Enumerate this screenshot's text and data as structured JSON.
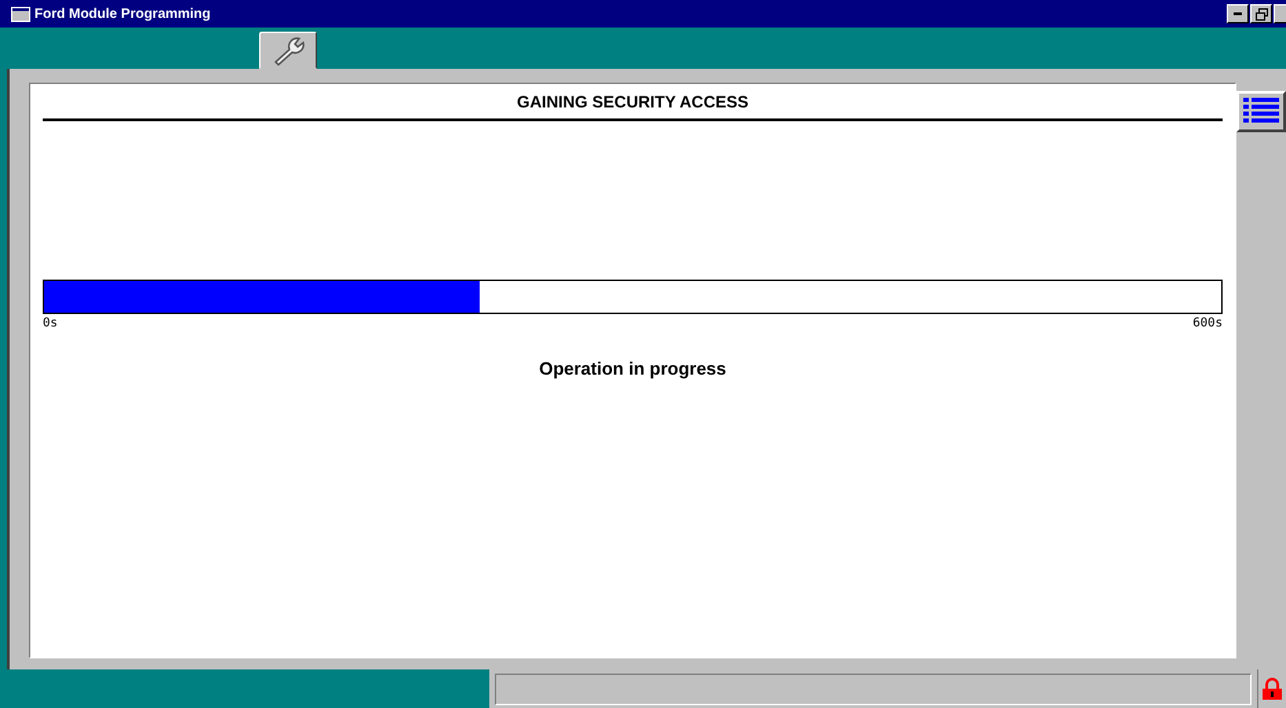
{
  "window": {
    "title": "Ford Module Programming"
  },
  "tabs": [
    {
      "kind": "wrench",
      "selected": true
    }
  ],
  "panel": {
    "heading": "GAINING SECURITY ACCESS",
    "progress": {
      "level": 0.37,
      "min_label": "0s",
      "max_label": "600s"
    },
    "message": "Operation in progress"
  },
  "status_bar": {
    "locked": true
  }
}
